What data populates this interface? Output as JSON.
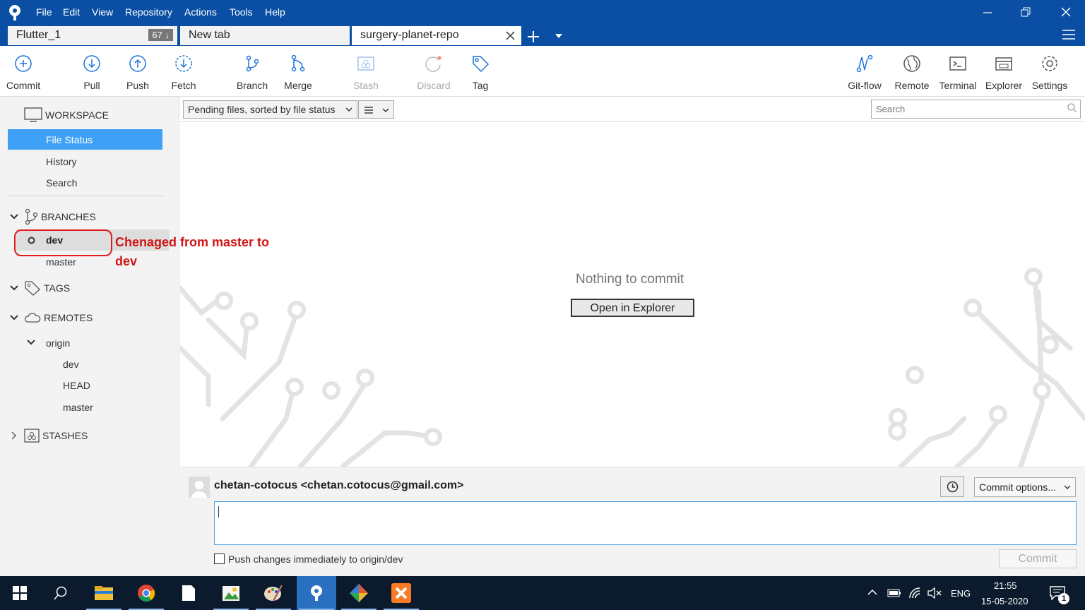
{
  "menu": [
    "File",
    "Edit",
    "View",
    "Repository",
    "Actions",
    "Tools",
    "Help"
  ],
  "tabs": [
    {
      "label": "Flutter_1",
      "badge": "67 ↓"
    },
    {
      "label": "New tab"
    },
    {
      "label": "surgery-planet-repo"
    }
  ],
  "toolbar": {
    "left": [
      "Commit",
      "Pull",
      "Push",
      "Fetch",
      "Branch",
      "Merge",
      "Stash",
      "Discard",
      "Tag"
    ],
    "right": [
      "Git-flow",
      "Remote",
      "Terminal",
      "Explorer",
      "Settings"
    ]
  },
  "sidebar": {
    "workspace": "WORKSPACE",
    "workspace_items": [
      "File Status",
      "History",
      "Search"
    ],
    "branches": "BRANCHES",
    "branch_items": [
      "dev",
      "master"
    ],
    "tags": "TAGS",
    "remotes": "REMOTES",
    "remote_origin": "origin",
    "remote_items": [
      "dev",
      "HEAD",
      "master"
    ],
    "stashes": "STASHES"
  },
  "filter": {
    "select": "Pending files, sorted by file status",
    "search_placeholder": "Search"
  },
  "content": {
    "empty_text": "Nothing to commit",
    "open_button": "Open in Explorer"
  },
  "commit": {
    "author": "chetan-cotocus <chetan.cotocus@gmail.com>",
    "options": "Commit options...",
    "push_label": "Push changes immediately to origin/dev",
    "button": "Commit"
  },
  "annotation": "Chenaged from master to dev",
  "taskbar": {
    "lang": "ENG",
    "time": "21:55",
    "date": "15-05-2020",
    "notif_count": "1"
  },
  "colors": {
    "title_bar": "#0a4fa3",
    "selection": "#3ea1f5",
    "annotation": "#d01515"
  }
}
